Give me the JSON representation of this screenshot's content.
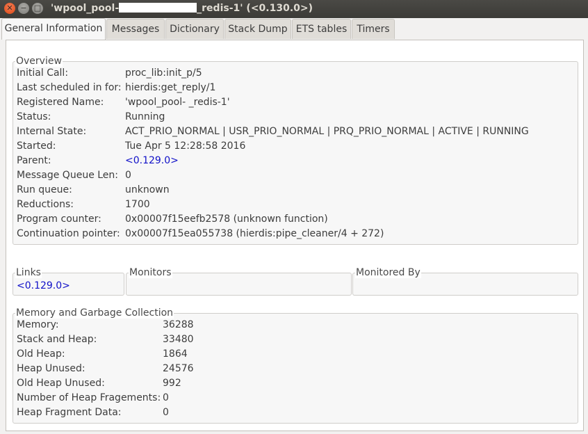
{
  "window": {
    "title_prefix": "'wpool_pool-",
    "title_suffix": "_redis-1' (<0.130.0>)",
    "buttons": {
      "close": "✕",
      "minimize": "−",
      "maximize": "□"
    }
  },
  "tabs": [
    {
      "label": "General Information",
      "active": true
    },
    {
      "label": "Messages"
    },
    {
      "label": "Dictionary"
    },
    {
      "label": "Stack Dump"
    },
    {
      "label": "ETS tables"
    },
    {
      "label": "Timers"
    }
  ],
  "overview": {
    "title": "Overview",
    "rows": [
      {
        "label": "Initial Call:",
        "value": "proc_lib:init_p/5"
      },
      {
        "label": "Last scheduled in for:",
        "value": "hierdis:get_reply/1"
      },
      {
        "label": "Registered Name:",
        "value": "'wpool_pool-                         _redis-1'"
      },
      {
        "label": "Status:",
        "value": "Running"
      },
      {
        "label": "Internal State:",
        "value": "ACT_PRIO_NORMAL | USR_PRIO_NORMAL | PRQ_PRIO_NORMAL | ACTIVE | RUNNING"
      },
      {
        "label": "Started:",
        "value": "Tue Apr  5 12:28:58 2016"
      },
      {
        "label": "Parent:",
        "value": "<0.129.0>"
      },
      {
        "label": "Message Queue Len:",
        "value": "0"
      },
      {
        "label": "Run queue:",
        "value": "unknown"
      },
      {
        "label": "Reductions:",
        "value": "1700"
      },
      {
        "label": "Program counter:",
        "value": "0x00007f15eefb2578 (unknown function)"
      },
      {
        "label": "Continuation pointer:",
        "value": "0x00007f15ea055738 (hierdis:pipe_cleaner/4 + 272)"
      }
    ]
  },
  "links": {
    "title": "Links",
    "value": "<0.129.0>"
  },
  "monitors": {
    "title": "Monitors"
  },
  "monitored_by": {
    "title": "Monitored By"
  },
  "memory": {
    "title": "Memory and Garbage Collection",
    "rows": [
      {
        "label": "Memory:",
        "value": "36288"
      },
      {
        "label": "Stack and Heap:",
        "value": "33480"
      },
      {
        "label": "Old Heap:",
        "value": "1864"
      },
      {
        "label": "Heap Unused:",
        "value": "24576"
      },
      {
        "label": "Old Heap Unused:",
        "value": "992"
      },
      {
        "label": "Number of Heap Fragements:",
        "value": "0"
      },
      {
        "label": "Heap Fragment Data:",
        "value": "0"
      }
    ]
  },
  "colors": {
    "link": "#1010c8",
    "titlebar": "#3c3b37",
    "close_button": "#df4a16"
  }
}
